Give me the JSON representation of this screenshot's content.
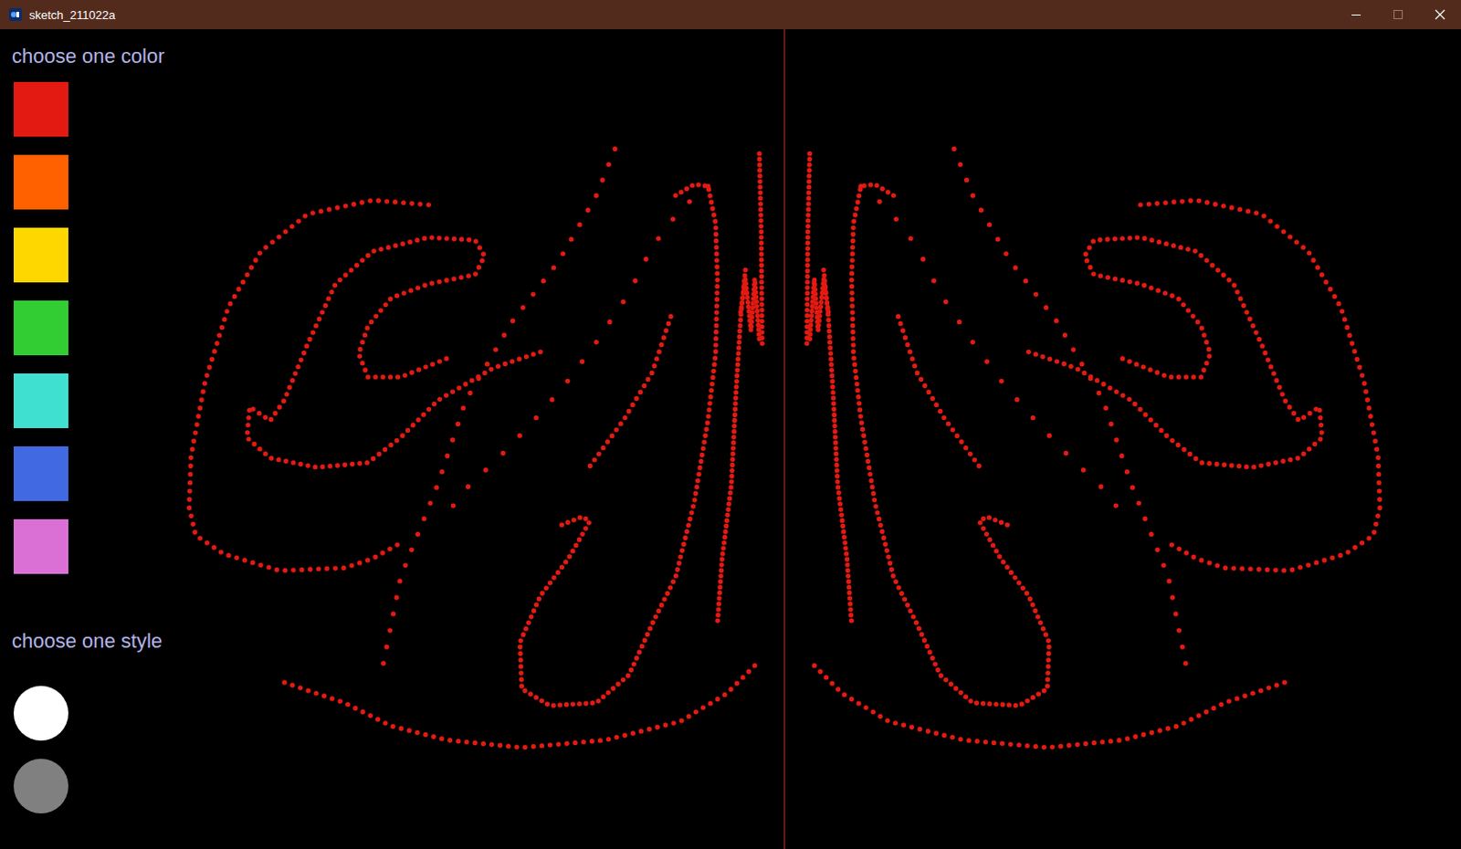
{
  "window": {
    "title": "sketch_211022a"
  },
  "color_panel": {
    "label": "choose one color",
    "swatches": [
      {
        "color": "#e31a12"
      },
      {
        "color": "#ff6000"
      },
      {
        "color": "#ffd700"
      },
      {
        "color": "#32cd32"
      },
      {
        "color": "#40e0d0"
      },
      {
        "color": "#4169e1"
      },
      {
        "color": "#da70d6"
      }
    ]
  },
  "style_panel": {
    "label": "choose one style",
    "styles": [
      {
        "color": "#ffffff"
      },
      {
        "color": "#808080"
      }
    ]
  },
  "canvas": {
    "brush_color": "#e31a12"
  }
}
